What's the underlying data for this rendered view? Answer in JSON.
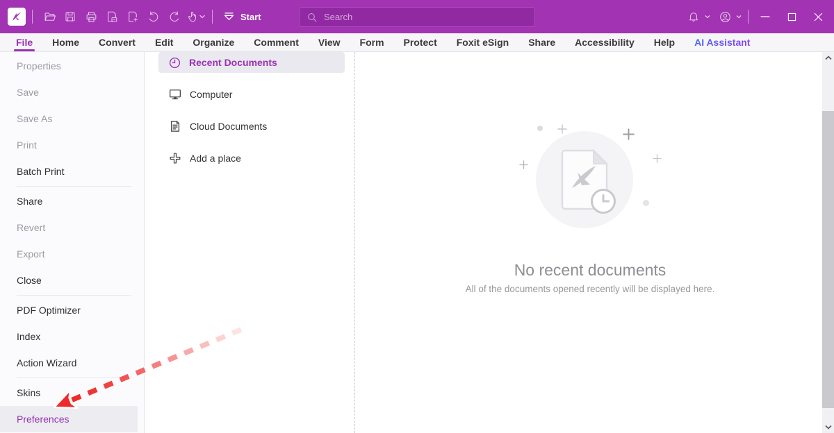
{
  "colors": {
    "toolbar_purple": "#a233b3",
    "search_field_purple": "#9129a2",
    "accent_purple": "#9c30b4",
    "ai_gradient_start": "#3f6df2",
    "ai_gradient_end": "#9b3df0",
    "arrow_red": "#ee2b2b",
    "selected_row_gray": "#ececf1"
  },
  "toolbar": {
    "search_placeholder": "Search",
    "start_label": "Start",
    "quick_access_icons": [
      "foxit-logo",
      "open-folder",
      "save",
      "print",
      "export-pdf",
      "create-pdf",
      "undo",
      "redo",
      "hand-tool"
    ],
    "right_icons": [
      "notification-bell",
      "account",
      "minimize",
      "maximize",
      "close"
    ]
  },
  "menubar": {
    "items": [
      {
        "label": "File",
        "state": "active"
      },
      {
        "label": "Home",
        "state": "normal"
      },
      {
        "label": "Convert",
        "state": "normal"
      },
      {
        "label": "Edit",
        "state": "normal"
      },
      {
        "label": "Organize",
        "state": "normal"
      },
      {
        "label": "Comment",
        "state": "normal"
      },
      {
        "label": "View",
        "state": "normal"
      },
      {
        "label": "Form",
        "state": "normal"
      },
      {
        "label": "Protect",
        "state": "normal"
      },
      {
        "label": "Foxit eSign",
        "state": "normal"
      },
      {
        "label": "Share",
        "state": "normal"
      },
      {
        "label": "Accessibility",
        "state": "normal"
      },
      {
        "label": "Help",
        "state": "normal"
      },
      {
        "label": "AI Assistant",
        "state": "gradient"
      }
    ]
  },
  "file_menu": {
    "items": [
      {
        "label": "Properties",
        "state": "disabled"
      },
      {
        "label": "Save",
        "state": "disabled"
      },
      {
        "label": "Save As",
        "state": "disabled"
      },
      {
        "label": "Print",
        "state": "disabled"
      },
      {
        "label": "Batch Print",
        "state": "normal"
      },
      {
        "label": "Share",
        "state": "normal"
      },
      {
        "label": "Revert",
        "state": "disabled"
      },
      {
        "label": "Export",
        "state": "disabled"
      },
      {
        "label": "Close",
        "state": "normal"
      },
      {
        "label": "PDF Optimizer",
        "state": "normal"
      },
      {
        "label": "Index",
        "state": "normal"
      },
      {
        "label": "Action Wizard",
        "state": "normal"
      },
      {
        "label": "Skins",
        "state": "normal"
      },
      {
        "label": "Preferences",
        "state": "selected"
      }
    ]
  },
  "places": {
    "items": [
      {
        "label": "Recent Documents",
        "icon": "clock-icon",
        "selected": true
      },
      {
        "label": "Computer",
        "icon": "monitor-icon",
        "selected": false
      },
      {
        "label": "Cloud Documents",
        "icon": "document-icon",
        "selected": false
      },
      {
        "label": "Add a place",
        "icon": "plus-icon",
        "selected": false
      }
    ]
  },
  "empty_state": {
    "title": "No recent documents",
    "subtitle": "All of the documents opened recently will be displayed here."
  }
}
